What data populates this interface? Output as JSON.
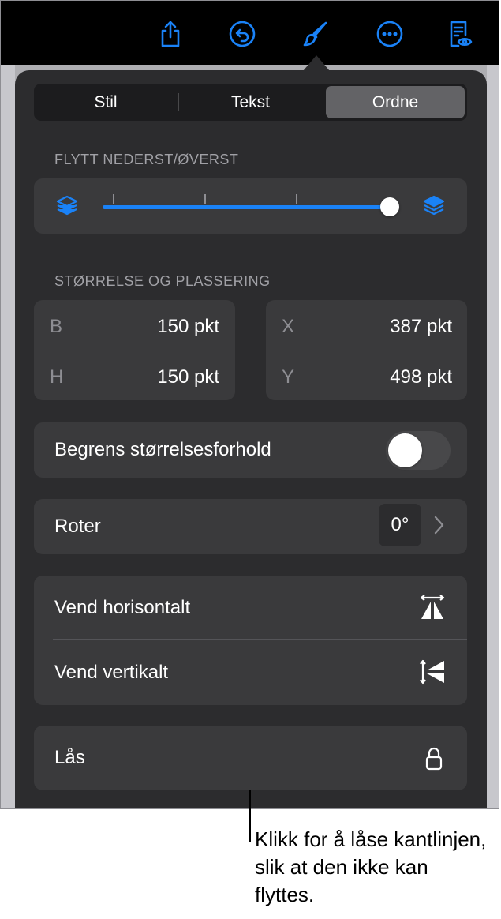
{
  "toolbar": {
    "icons": [
      "share-icon",
      "undo-icon",
      "format-brush-icon",
      "more-icon",
      "reader-view-icon"
    ],
    "accent_color": "#1a82f7"
  },
  "tabs": {
    "items": [
      "Stil",
      "Tekst",
      "Ordne"
    ],
    "selected": "Ordne"
  },
  "layer_section": {
    "title": "FLYTT NEDERST/ØVERST",
    "position_fraction": 1.0,
    "left_icon": "send-to-back-icon",
    "right_icon": "bring-to-front-icon"
  },
  "size_section": {
    "title": "STØRRELSE OG PLASSERING",
    "size": {
      "width_label": "B",
      "width_value": "150 pkt",
      "height_label": "H",
      "height_value": "150 pkt"
    },
    "position": {
      "x_label": "X",
      "x_value": "387 pkt",
      "y_label": "Y",
      "y_value": "498 pkt"
    }
  },
  "constrain": {
    "label": "Begrens størrelsesforhold",
    "enabled": false
  },
  "rotate": {
    "label": "Roter",
    "value": "0°"
  },
  "flip": {
    "horizontal_label": "Vend horisontalt",
    "vertical_label": "Vend vertikalt"
  },
  "lock": {
    "label": "Lås",
    "icon": "lock-icon"
  },
  "callout": {
    "text": "Klikk for å låse kantlinjen, slik at den ikke kan flyttes."
  }
}
